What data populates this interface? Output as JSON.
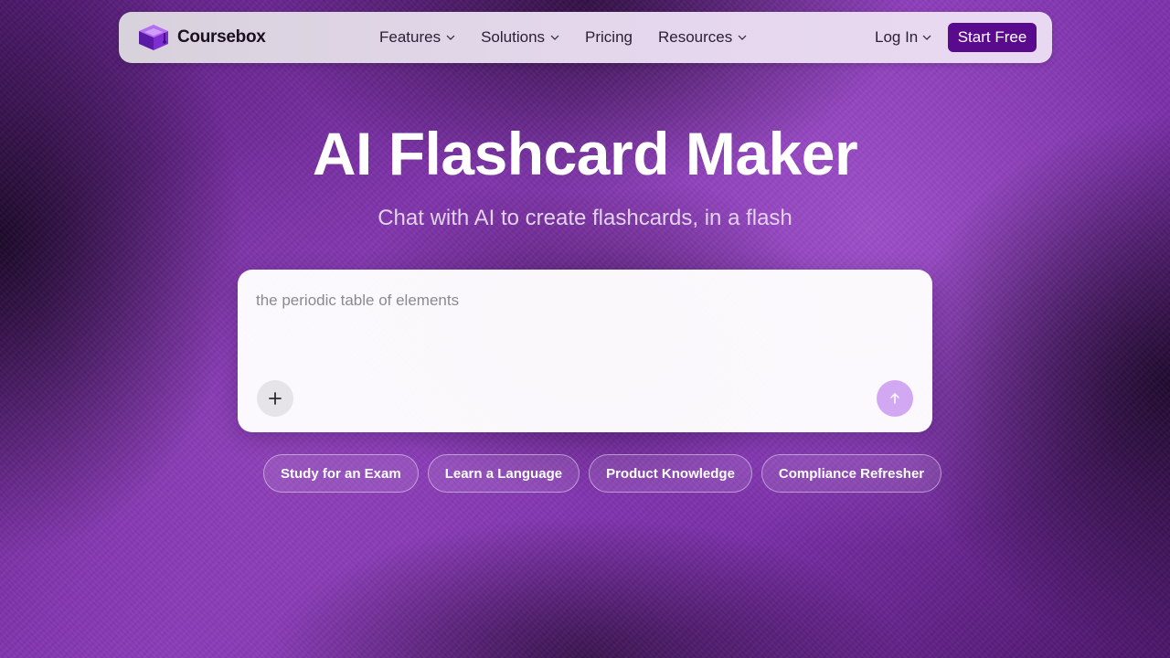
{
  "nav": {
    "brand_name": "Coursebox",
    "brand_icon": "graduation-cap-cube-icon",
    "links": [
      {
        "label": "Features",
        "has_dropdown": true
      },
      {
        "label": "Solutions",
        "has_dropdown": true
      },
      {
        "label": "Pricing",
        "has_dropdown": false
      },
      {
        "label": "Resources",
        "has_dropdown": true
      }
    ],
    "login_label": "Log In",
    "cta_label": "Start Free",
    "cta_color": "#5a0a8c"
  },
  "hero": {
    "title": "AI Flashcard Maker",
    "subtitle": "Chat with AI to create flashcards, in a flash"
  },
  "prompt": {
    "placeholder": "the periodic table of elements",
    "value": "",
    "add_icon": "plus-icon",
    "send_icon": "arrow-up-icon",
    "send_color": "#d3a8f2"
  },
  "suggestions": [
    "Study for an Exam",
    "Learn a Language",
    "Product Knowledge",
    "Compliance Refresher"
  ],
  "colors": {
    "background_accent": "#8a3ab8"
  }
}
